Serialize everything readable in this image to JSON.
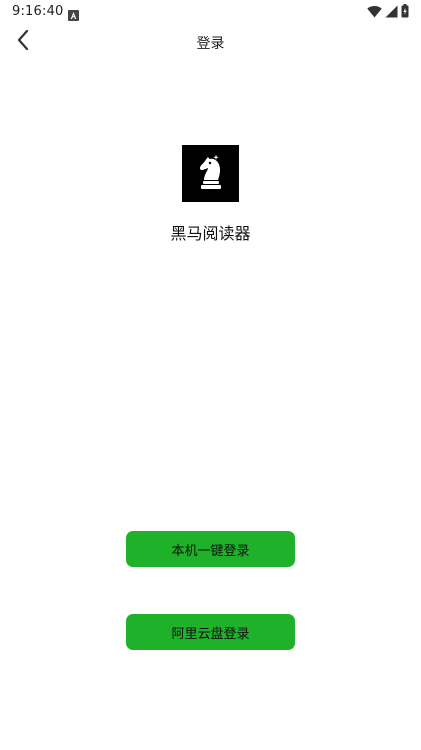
{
  "status_bar": {
    "time": "9:16:40",
    "notification_icon": "a-notification-icon",
    "wifi_icon": "wifi-icon",
    "signal_icon": "signal-icon",
    "battery_icon": "battery-charging-icon"
  },
  "header": {
    "back_icon": "chevron-left-icon",
    "title": "登录"
  },
  "app": {
    "logo_icon": "chess-knight-icon",
    "name": "黑马阅读器"
  },
  "actions": {
    "local_login_label": "本机一键登录",
    "aliyun_login_label": "阿里云盘登录"
  },
  "colors": {
    "accent": "#1fb12a",
    "logo_bg": "#000000"
  }
}
